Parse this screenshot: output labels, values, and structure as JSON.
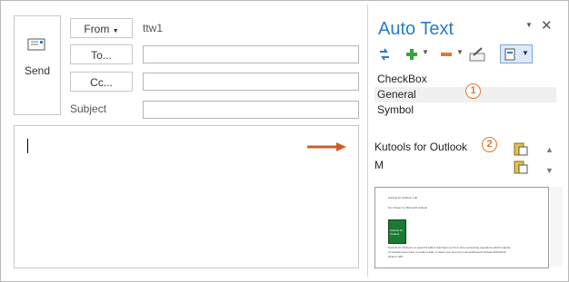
{
  "compose": {
    "send_label": "Send",
    "from_label": "From",
    "from_value": "ttw1",
    "to_label": "To...",
    "cc_label": "Cc...",
    "subject_label": "Subject"
  },
  "pane": {
    "title": "Auto Text",
    "categories": [
      "CheckBox",
      "General",
      "Symbol"
    ],
    "entries": [
      "Kutools for Outlook",
      "M"
    ],
    "markers": [
      "1",
      "2"
    ]
  },
  "preview": {
    "lines": [
      "Kutools for Outlook 1.00",
      "10+ Power for Microsoft Outlook",
      "Kutools for Outlook is a powerful add-in that frees you from time-consuming operations which majority",
      "of Outlook users have to perform daily. It saves your time from using Microsoft Outlook 2010/2013,",
      "2016 or 365"
    ],
    "book_caption": "Kutools for Outlook"
  },
  "colors": {
    "accent": "#2a7cc7",
    "marker": "#e0782a",
    "arrow": "#d35b2a"
  }
}
